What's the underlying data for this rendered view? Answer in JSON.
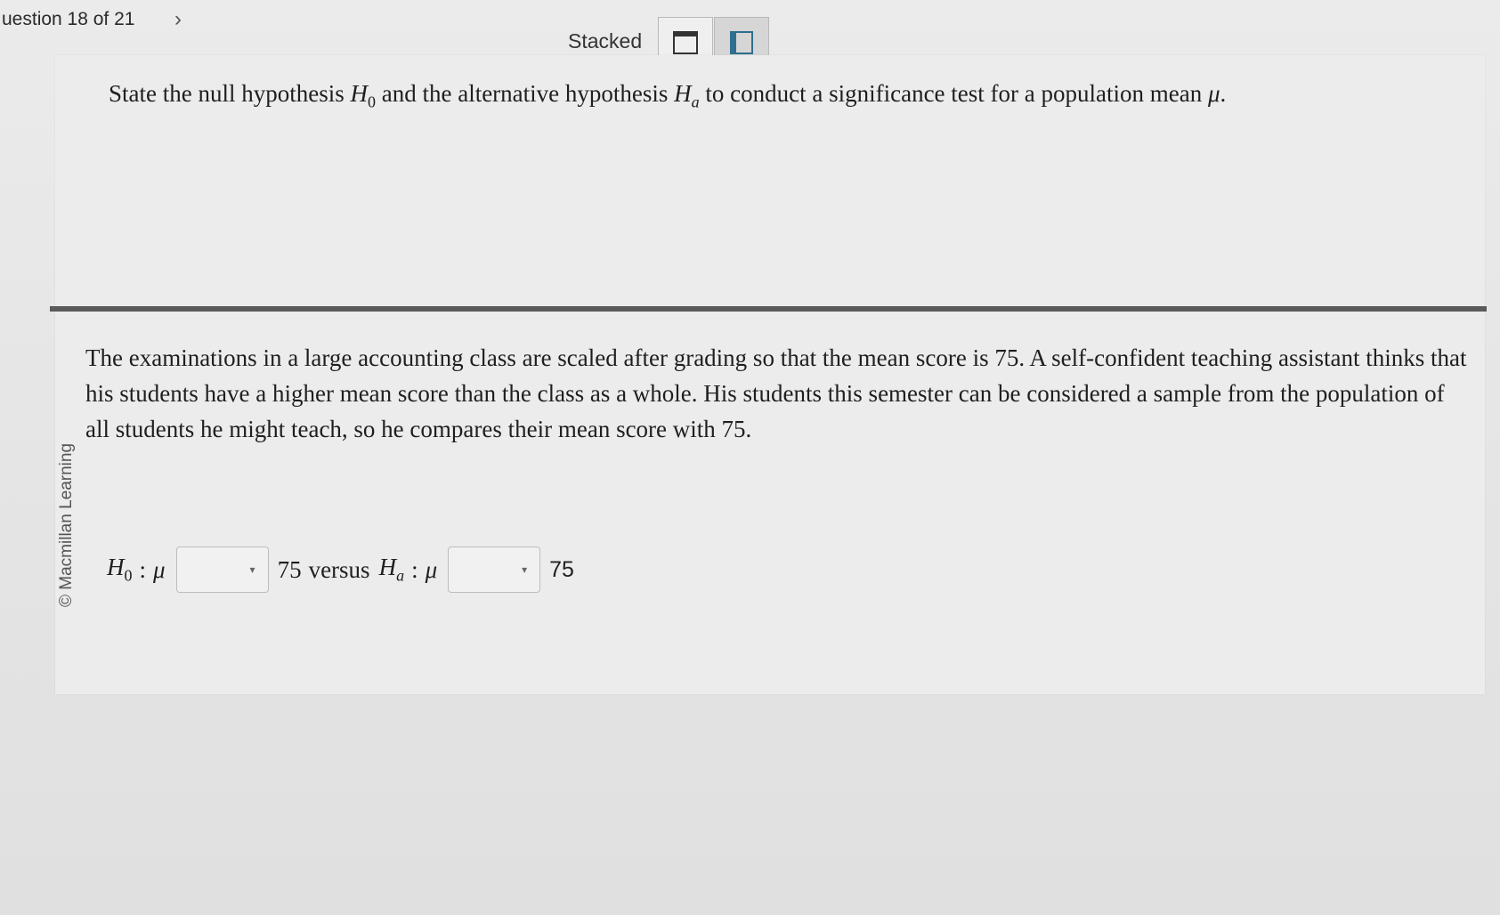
{
  "header": {
    "question_counter": "uestion 18 of 21",
    "next_icon": "chevron-right-icon",
    "next_glyph": "›",
    "view_mode_label": "Stacked",
    "view_buttons": [
      {
        "name": "stacked-view-button",
        "icon": "stacked-layout-icon"
      },
      {
        "name": "side-by-side-view-button",
        "icon": "split-layout-icon"
      }
    ]
  },
  "prompt": {
    "before_h0": "State the null hypothesis ",
    "h0_symbol": "H",
    "h0_sub": "0",
    "middle": " and the alternative hypothesis ",
    "ha_symbol": "H",
    "ha_sub": "a",
    "after_ha": " to conduct a significance test for a population mean ",
    "mu": "μ",
    "end": "."
  },
  "copyright": "© Macmillan Learning",
  "scenario": {
    "text": "The examinations in a large accounting class are scaled after grading so that the mean score is 75. A self-confident teaching assistant thinks that his students have a higher mean score than the class as a whole. His students this semester can be considered a sample from the population of all students he might teach, so he compares their mean score with 75."
  },
  "answer": {
    "h0_symbol": "H",
    "h0_sub": "0",
    "colon": ":",
    "mu": "μ",
    "dropdown1_value": "",
    "value1": "75",
    "versus": "versus",
    "ha_symbol": "H",
    "ha_sub": "a",
    "dropdown2_value": "",
    "value2": "75",
    "caret_glyph": "▾"
  }
}
